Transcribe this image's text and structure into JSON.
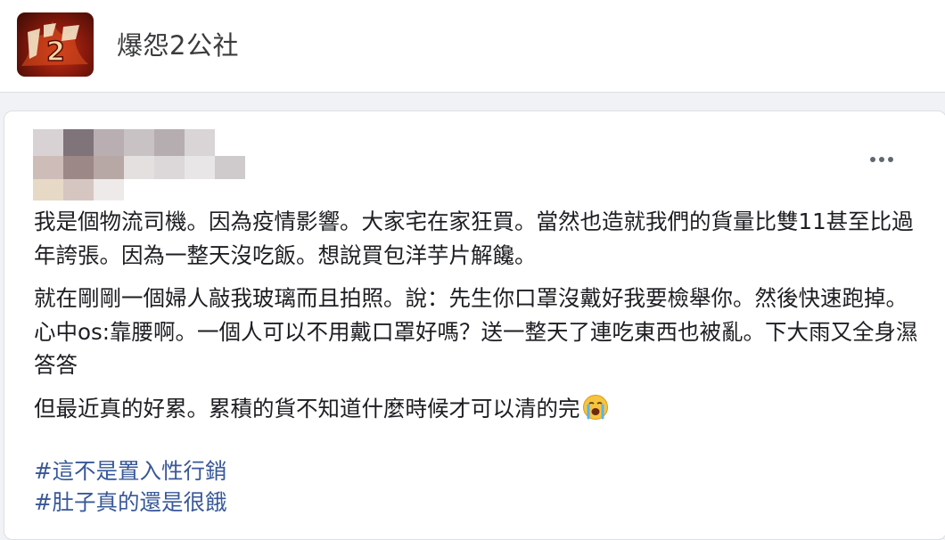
{
  "group": {
    "name": "爆怨2公社",
    "avatar_icon": "group-logo-icon"
  },
  "post": {
    "more_icon": "more-options-icon",
    "paragraphs": [
      "我是個物流司機。因為疫情影響。大家宅在家狂買。當然也造就我們的貨量比雙11甚至比過年誇張。因為一整天沒吃飯。想說買包洋芋片解饞。",
      "就在剛剛一個婦人敲我玻璃而且拍照。說：先生你口罩沒戴好我要檢舉你。然後快速跑掉。心中os:靠腰啊。一個人可以不用戴口罩好嗎？送一整天了連吃東西也被亂。下大雨又全身濕答答",
      "但最近真的好累。累積的貨不知道什麼時候才可以清的完"
    ],
    "emoji_icon": "crying-face-emoji",
    "hashtags": [
      "#這不是置入性行銷",
      "#肚子真的還是很餓"
    ]
  },
  "colors": {
    "page_bg": "#f0f2f5",
    "card_bg": "#ffffff",
    "hashtag": "#385898",
    "text": "#1c1e21"
  }
}
